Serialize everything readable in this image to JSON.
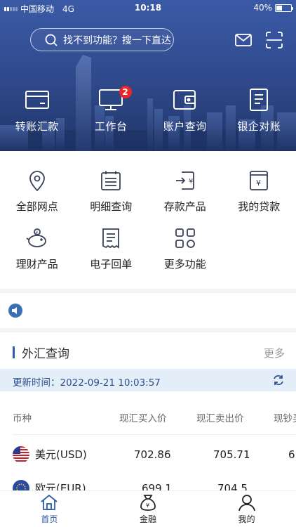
{
  "status_bar": {
    "carrier": "中国移动",
    "network": "4G",
    "time": "10:18",
    "battery_text": "40%",
    "battery_level": 0.4
  },
  "header": {
    "search_placeholder": "找不到功能？搜一下直达",
    "icons": [
      "message-icon",
      "scan-icon"
    ]
  },
  "quick_actions": [
    {
      "label": "转账汇款",
      "icon": "card-icon"
    },
    {
      "label": "工作台",
      "icon": "monitor-icon",
      "badge": "2"
    },
    {
      "label": "账户查询",
      "icon": "wallet-icon"
    },
    {
      "label": "银企对账",
      "icon": "document-icon"
    }
  ],
  "functions": [
    {
      "label": "全部网点",
      "icon": "location-icon"
    },
    {
      "label": "明细查询",
      "icon": "calendar-list-icon"
    },
    {
      "label": "存款产品",
      "icon": "deposit-icon"
    },
    {
      "label": "我的贷款",
      "icon": "loan-icon"
    },
    {
      "label": "理财产品",
      "icon": "piggy-bank-icon"
    },
    {
      "label": "电子回单",
      "icon": "receipt-icon"
    },
    {
      "label": "更多功能",
      "icon": "grid-more-icon"
    }
  ],
  "fx": {
    "title": "外汇查询",
    "more": "更多",
    "update_label": "更新时间：",
    "update_time": "2022-09-21 10:03:57",
    "columns": [
      "币种",
      "现汇买入价",
      "现汇卖出价",
      "现钞买"
    ],
    "rows": [
      {
        "currency": "美元(USD)",
        "flag": "us-flag-icon",
        "buy": "702.86",
        "sell": "705.71",
        "cash": "6"
      },
      {
        "currency": "欧元(EUR)",
        "flag": "eu-flag-icon",
        "buy": "699.1",
        "sell": "704.5",
        "cash": ""
      }
    ]
  },
  "tabbar": [
    {
      "label": "首页",
      "icon": "home-icon",
      "active": true
    },
    {
      "label": "金融",
      "icon": "money-bag-icon",
      "active": false
    },
    {
      "label": "我的",
      "icon": "user-icon",
      "active": false
    }
  ],
  "colors": {
    "primary": "#2d5aa5",
    "badge": "#e8272c",
    "update_bg": "#e4eef9"
  }
}
